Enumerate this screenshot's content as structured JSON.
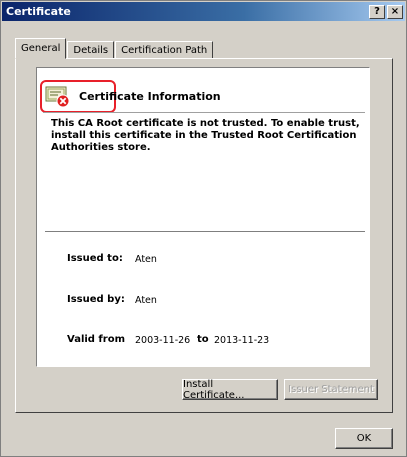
{
  "window": {
    "title": "Certificate",
    "help_label": "?",
    "close_label": "×"
  },
  "tabs": [
    {
      "label": "General",
      "active": true
    },
    {
      "label": "Details",
      "active": false
    },
    {
      "label": "Certification Path",
      "active": false
    }
  ],
  "info": {
    "header": "Certificate Information",
    "warning": "This CA Root certificate is not trusted. To enable trust, install this certificate in the Trusted Root Certification Authorities store.",
    "icon": "certificate-error-icon",
    "highlight_color": "#e8202a"
  },
  "fields": {
    "issued_to_label": "Issued to:",
    "issued_to_value": "Aten",
    "issued_by_label": "Issued by:",
    "issued_by_value": "Aten",
    "valid_from_label": "Valid from",
    "valid_from_value": "2003-11-26",
    "to_label": "to",
    "valid_to_value": "2013-11-23"
  },
  "buttons": {
    "install": "Install Certificate...",
    "issuer_statement": "Issuer Statement",
    "ok": "OK"
  }
}
